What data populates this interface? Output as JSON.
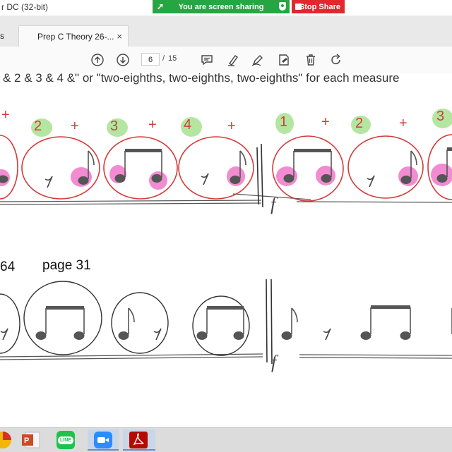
{
  "window": {
    "title": "r DC (32-bit)"
  },
  "screen_share": {
    "status": "You are screen sharing",
    "stop_label": "Stop Share"
  },
  "tabs": [
    {
      "label": "s"
    },
    {
      "label": "Prep C Theory 26-...",
      "close": "×"
    }
  ],
  "toolbar": {
    "page_current": "6",
    "page_separator": "/",
    "page_total": "15"
  },
  "document": {
    "instruction": "& 2 & 3 & 4 &\"  or  \"two-eighths, two-eighths, two-eighths\"  for each measure",
    "counts_row": [
      "+",
      "2",
      "+",
      "3",
      "+",
      "4",
      "+",
      "1",
      "+",
      "2",
      "+",
      "3"
    ],
    "page_number_left": "64",
    "page_label": "page 31",
    "dynamic_top": "f",
    "dynamic_bottom": "f"
  },
  "colors": {
    "share_green": "#26a643",
    "stop_red": "#e0282e",
    "annotation_red": "#d03e3c",
    "highlight_green": "#b5e6a1",
    "highlight_pink": "#ef6fc6"
  },
  "taskbar": {
    "items": [
      "chrome-icon",
      "powerpoint-icon",
      "line-app-icon",
      "zoom-icon",
      "acrobat-icon"
    ],
    "line_label": "LINE"
  }
}
